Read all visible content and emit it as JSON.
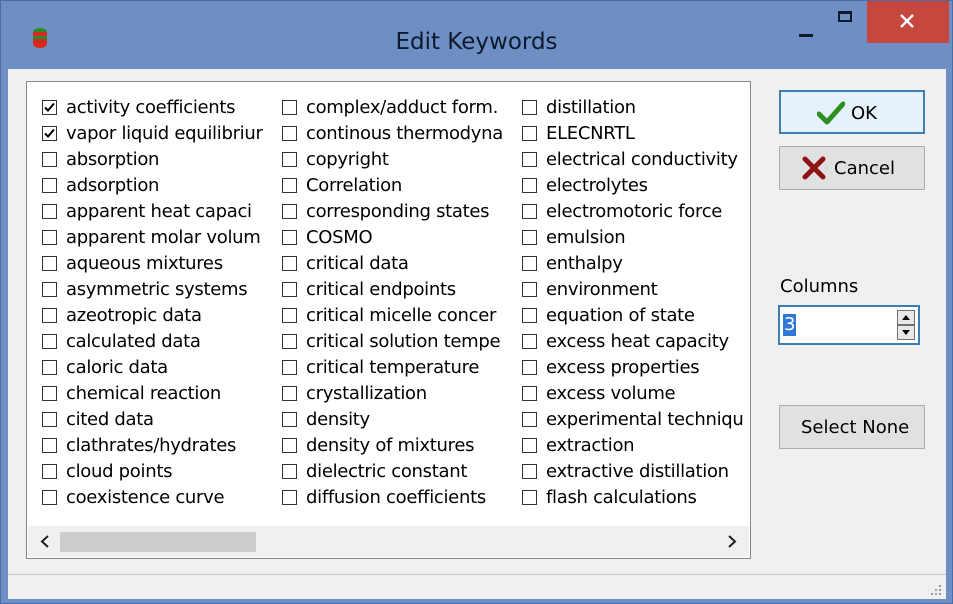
{
  "window": {
    "title": "Edit Keywords"
  },
  "keywords": {
    "columns": [
      [
        {
          "label": "activity coefficients",
          "checked": true
        },
        {
          "label": "vapor liquid equilibriur",
          "checked": true
        },
        {
          "label": "absorption",
          "checked": false
        },
        {
          "label": "adsorption",
          "checked": false
        },
        {
          "label": "apparent heat capaci",
          "checked": false
        },
        {
          "label": "apparent molar volum",
          "checked": false
        },
        {
          "label": "aqueous mixtures",
          "checked": false
        },
        {
          "label": "asymmetric systems",
          "checked": false
        },
        {
          "label": "azeotropic data",
          "checked": false
        },
        {
          "label": "calculated data",
          "checked": false
        },
        {
          "label": "caloric data",
          "checked": false
        },
        {
          "label": "chemical reaction",
          "checked": false
        },
        {
          "label": "cited data",
          "checked": false
        },
        {
          "label": "clathrates/hydrates",
          "checked": false
        },
        {
          "label": "cloud points",
          "checked": false
        },
        {
          "label": "coexistence curve",
          "checked": false
        }
      ],
      [
        {
          "label": "complex/adduct form.",
          "checked": false
        },
        {
          "label": "continous thermodyna",
          "checked": false
        },
        {
          "label": "copyright",
          "checked": false
        },
        {
          "label": "Correlation",
          "checked": false
        },
        {
          "label": "corresponding states",
          "checked": false
        },
        {
          "label": "COSMO",
          "checked": false
        },
        {
          "label": "critical data",
          "checked": false
        },
        {
          "label": "critical endpoints",
          "checked": false
        },
        {
          "label": "critical micelle concer",
          "checked": false
        },
        {
          "label": "critical solution tempe",
          "checked": false
        },
        {
          "label": "critical temperature",
          "checked": false
        },
        {
          "label": "crystallization",
          "checked": false
        },
        {
          "label": "density",
          "checked": false
        },
        {
          "label": "density of mixtures",
          "checked": false
        },
        {
          "label": "dielectric constant",
          "checked": false
        },
        {
          "label": "diffusion coefficients",
          "checked": false
        }
      ],
      [
        {
          "label": "distillation",
          "checked": false
        },
        {
          "label": "ELECNRTL",
          "checked": false
        },
        {
          "label": "electrical conductivity",
          "checked": false
        },
        {
          "label": "electrolytes",
          "checked": false
        },
        {
          "label": "electromotoric force",
          "checked": false
        },
        {
          "label": "emulsion",
          "checked": false
        },
        {
          "label": "enthalpy",
          "checked": false
        },
        {
          "label": "environment",
          "checked": false
        },
        {
          "label": "equation of state",
          "checked": false
        },
        {
          "label": "excess heat capacity",
          "checked": false
        },
        {
          "label": "excess properties",
          "checked": false
        },
        {
          "label": "excess volume",
          "checked": false
        },
        {
          "label": "experimental techniqu",
          "checked": false
        },
        {
          "label": "extraction",
          "checked": false
        },
        {
          "label": "extractive distillation",
          "checked": false
        },
        {
          "label": "flash calculations",
          "checked": false
        }
      ]
    ]
  },
  "buttons": {
    "ok_label": "OK",
    "cancel_label": "Cancel",
    "select_none_label": "Select None"
  },
  "columns_control": {
    "label": "Columns",
    "value": "3"
  },
  "icons": {
    "ok": "checkmark-icon",
    "cancel": "x-icon",
    "app": "app-icon"
  },
  "colors": {
    "titlebar": "#6d8fc4",
    "close": "#c7463d",
    "ok_check": "#2f8f1e",
    "cancel_x": "#8e1414"
  }
}
